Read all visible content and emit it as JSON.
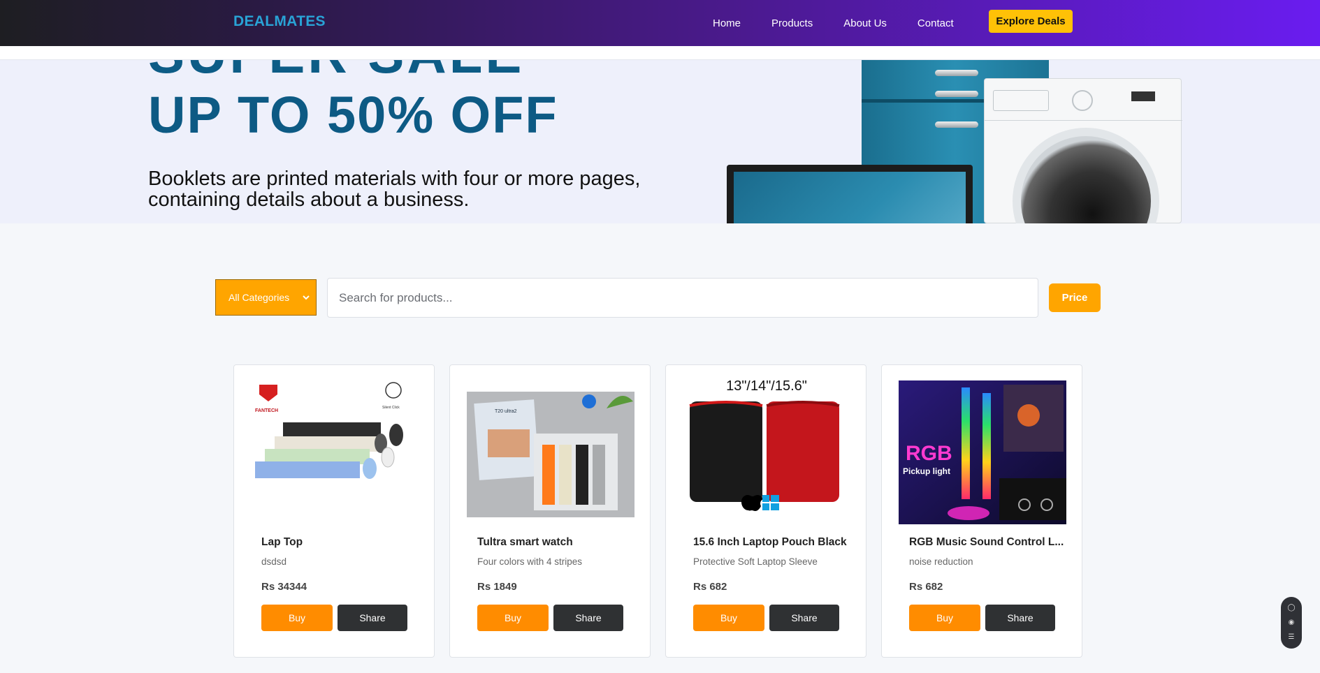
{
  "header": {
    "brand": "DEALMATES",
    "nav": [
      "Home",
      "Products",
      "About Us",
      "Contact"
    ],
    "cta": "Explore Deals"
  },
  "hero": {
    "clipped_text": "SUPER SALE",
    "title": "UP TO 50% OFF",
    "subtitle": "Booklets are printed materials with four or more pages, containing details about a business."
  },
  "filters": {
    "category": "All Categories",
    "search_placeholder": "Search for products...",
    "price_label": "Price"
  },
  "products": [
    {
      "name": "Lap Top",
      "description": "dsdsd",
      "price": "Rs 34344",
      "buy": "Buy",
      "share": "Share",
      "brand_mark": "FANTECH",
      "brand_mark_right": "Silent Click"
    },
    {
      "name": "Tultra smart watch",
      "description": "Four colors with 4 stripes",
      "price": "Rs 1849",
      "buy": "Buy",
      "share": "Share",
      "box_label": "T20 ultra2"
    },
    {
      "name": "15.6 Inch Laptop Pouch Black",
      "description": "Protective Soft Laptop Sleeve",
      "price": "Rs 682",
      "buy": "Buy",
      "share": "Share",
      "sizes": "13\"/14\"/15.6\""
    },
    {
      "name": "RGB Music Sound Control L...",
      "description": "noise reduction",
      "price": "Rs 682",
      "buy": "Buy",
      "share": "Share",
      "img_title": "RGB",
      "img_sub": "Pickup light"
    }
  ],
  "colors": {
    "accent": "#ffa500",
    "buy": "#ff8c00",
    "cta": "#ffc107",
    "brand": "#29a3d6",
    "hero_title": "#0d5a84"
  }
}
